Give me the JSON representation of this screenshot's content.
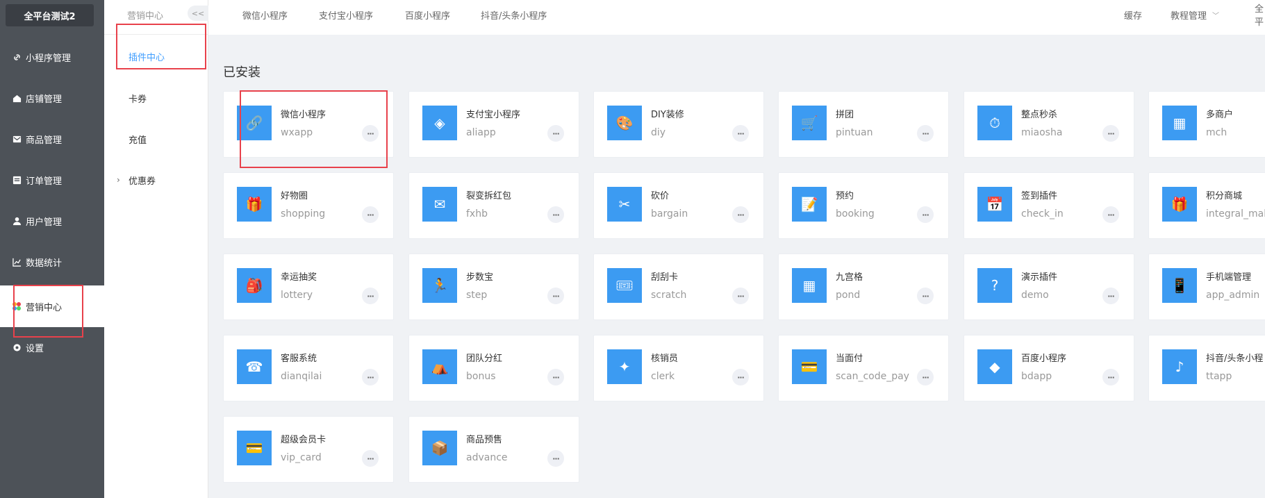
{
  "brand": "全平台测试2",
  "sidebar": {
    "items": [
      {
        "label": "小程序管理",
        "icon": "link-icon"
      },
      {
        "label": "店铺管理",
        "icon": "home-icon"
      },
      {
        "label": "商品管理",
        "icon": "mail-icon"
      },
      {
        "label": "订单管理",
        "icon": "order-icon"
      },
      {
        "label": "用户管理",
        "icon": "user-icon"
      },
      {
        "label": "数据统计",
        "icon": "chart-icon"
      },
      {
        "label": "营销中心",
        "icon": "marketing-icon",
        "active": true
      },
      {
        "label": "设置",
        "icon": "gear-icon"
      }
    ]
  },
  "submenu": {
    "title": "营销中心",
    "collapse": "<<",
    "items": [
      {
        "label": "插件中心",
        "active": true
      },
      {
        "label": "卡券"
      },
      {
        "label": "充值"
      },
      {
        "label": "优惠券",
        "expandable": true
      }
    ]
  },
  "topnav": {
    "tabs": [
      "微信小程序",
      "支付宝小程序",
      "百度小程序",
      "抖音/头条小程序"
    ],
    "right": {
      "cache": "缓存",
      "tutorial": "教程管理",
      "more": "全平"
    }
  },
  "section_title": "已安装",
  "more_label": "···",
  "plugins": [
    {
      "name": "微信小程序",
      "code": "wxapp"
    },
    {
      "name": "支付宝小程序",
      "code": "aliapp"
    },
    {
      "name": "DIY装修",
      "code": "diy"
    },
    {
      "name": "拼团",
      "code": "pintuan"
    },
    {
      "name": "整点秒杀",
      "code": "miaosha"
    },
    {
      "name": "多商户",
      "code": "mch"
    },
    {
      "name": "好物圈",
      "code": "shopping"
    },
    {
      "name": "裂变拆红包",
      "code": "fxhb"
    },
    {
      "name": "砍价",
      "code": "bargain"
    },
    {
      "name": "预约",
      "code": "booking"
    },
    {
      "name": "签到插件",
      "code": "check_in"
    },
    {
      "name": "积分商城",
      "code": "integral_mall"
    },
    {
      "name": "幸运抽奖",
      "code": "lottery"
    },
    {
      "name": "步数宝",
      "code": "step"
    },
    {
      "name": "刮刮卡",
      "code": "scratch"
    },
    {
      "name": "九宫格",
      "code": "pond"
    },
    {
      "name": "演示插件",
      "code": "demo"
    },
    {
      "name": "手机端管理",
      "code": "app_admin"
    },
    {
      "name": "客服系统",
      "code": "dianqilai"
    },
    {
      "name": "团队分红",
      "code": "bonus"
    },
    {
      "name": "核销员",
      "code": "clerk"
    },
    {
      "name": "当面付",
      "code": "scan_code_pay"
    },
    {
      "name": "百度小程序",
      "code": "bdapp"
    },
    {
      "name": "抖音/头条小程",
      "code": "ttapp"
    },
    {
      "name": "超级会员卡",
      "code": "vip_card"
    },
    {
      "name": "商品预售",
      "code": "advance"
    }
  ],
  "colors": {
    "sidebar": "#4d5258",
    "accent": "#409eff",
    "tile": "#3c9bf2",
    "highlight": "#e8414b"
  }
}
